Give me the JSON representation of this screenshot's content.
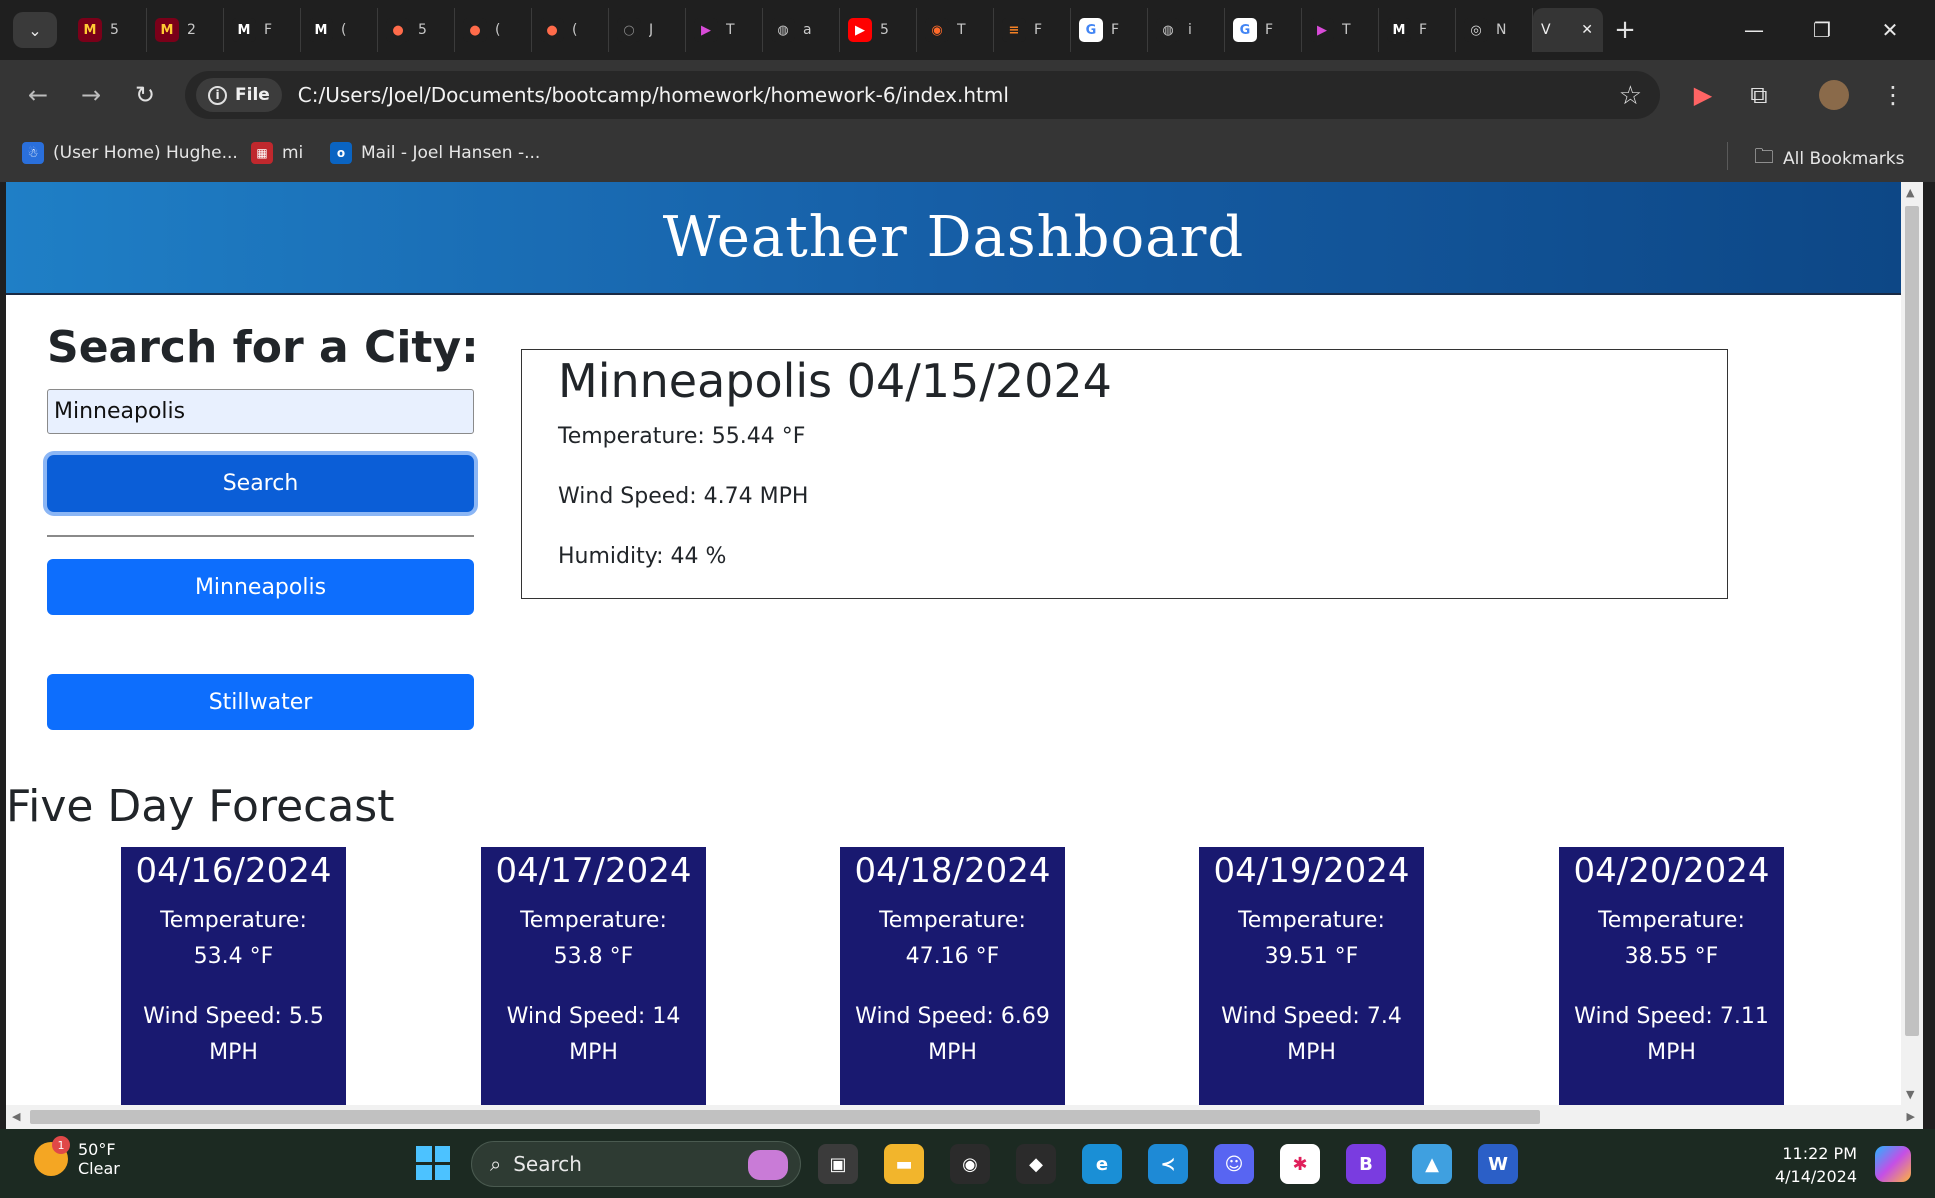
{
  "browser": {
    "tabs": [
      {
        "label": "5",
        "fav_text": "M",
        "fav_color": "#7a0019",
        "fav_fg": "#ffcc33"
      },
      {
        "label": "2",
        "fav_text": "M",
        "fav_color": "#7a0019",
        "fav_fg": "#ffcc33"
      },
      {
        "label": "F",
        "fav_text": "M",
        "fav_color": "#1f1f1f",
        "fav_fg": "#ffffff"
      },
      {
        "label": "(",
        "fav_text": "M",
        "fav_color": "#1f1f1f",
        "fav_fg": "#ffffff"
      },
      {
        "label": "5",
        "fav_text": "●",
        "fav_color": "#1f1f1f",
        "fav_fg": "#ff6b4a"
      },
      {
        "label": "(",
        "fav_text": "●",
        "fav_color": "#1f1f1f",
        "fav_fg": "#ff6b4a"
      },
      {
        "label": "(",
        "fav_text": "●",
        "fav_color": "#1f1f1f",
        "fav_fg": "#ff6b4a"
      },
      {
        "label": "J",
        "fav_text": "○",
        "fav_color": "#1f1f1f",
        "fav_fg": "#888888"
      },
      {
        "label": "T",
        "fav_text": "▶",
        "fav_color": "#1f1f1f",
        "fav_fg": "#d84bd8"
      },
      {
        "label": "a",
        "fav_text": "◍",
        "fav_color": "#1f1f1f",
        "fav_fg": "#cccccc"
      },
      {
        "label": "5",
        "fav_text": "▶",
        "fav_color": "#ff0000",
        "fav_fg": "#ffffff"
      },
      {
        "label": "T",
        "fav_text": "◉",
        "fav_color": "#1f1f1f",
        "fav_fg": "#ff6a2a"
      },
      {
        "label": "F",
        "fav_text": "≡",
        "fav_color": "#1f1f1f",
        "fav_fg": "#f48024"
      },
      {
        "label": "F",
        "fav_text": "G",
        "fav_color": "#ffffff",
        "fav_fg": "#4285f4"
      },
      {
        "label": "i",
        "fav_text": "◍",
        "fav_color": "#1f1f1f",
        "fav_fg": "#cccccc"
      },
      {
        "label": "F",
        "fav_text": "G",
        "fav_color": "#ffffff",
        "fav_fg": "#4285f4"
      },
      {
        "label": "T",
        "fav_text": "▶",
        "fav_color": "#1f1f1f",
        "fav_fg": "#d84bd8"
      },
      {
        "label": "F",
        "fav_text": "M",
        "fav_color": "#1f1f1f",
        "fav_fg": "#ffffff"
      },
      {
        "label": "N",
        "fav_text": "◎",
        "fav_color": "#1f1f1f",
        "fav_fg": "#dddddd"
      }
    ],
    "active_tab_label": "V",
    "url_scheme_chip": "File",
    "url": "C:/Users/Joel/Documents/bootcamp/homework/homework-6/index.html",
    "bookmarks": [
      {
        "label": "(User Home) Hughe...",
        "icon_color": "#2a6fdb",
        "icon_text": "☃"
      },
      {
        "label": "mi",
        "icon_color": "#c0282d",
        "icon_text": "▦"
      },
      {
        "label": "Mail - Joel Hansen -...",
        "icon_color": "#0a64c2",
        "icon_text": "o"
      }
    ],
    "all_bookmarks_label": "All Bookmarks"
  },
  "page": {
    "header_title": "Weather Dashboard",
    "search_title": "Search for a City:",
    "search_value": "Minneapolis",
    "search_button": "Search",
    "history": [
      "Minneapolis",
      "Stillwater"
    ],
    "current": {
      "heading": "Minneapolis 04/15/2024",
      "temperature": "Temperature: 55.44 °F",
      "wind": "Wind Speed: 4.74 MPH",
      "humidity": "Humidity: 44 %"
    },
    "forecast_title": "Five Day Forecast",
    "forecast": [
      {
        "date": "04/16/2024",
        "temp_label": "Temperature:",
        "temp": "53.4 °F",
        "wind_label": "Wind Speed: 5.5",
        "wind_unit": "MPH"
      },
      {
        "date": "04/17/2024",
        "temp_label": "Temperature:",
        "temp": "53.8 °F",
        "wind_label": "Wind Speed: 14",
        "wind_unit": "MPH"
      },
      {
        "date": "04/18/2024",
        "temp_label": "Temperature:",
        "temp": "47.16 °F",
        "wind_label": "Wind Speed: 6.69",
        "wind_unit": "MPH"
      },
      {
        "date": "04/19/2024",
        "temp_label": "Temperature:",
        "temp": "39.51 °F",
        "wind_label": "Wind Speed: 7.4",
        "wind_unit": "MPH"
      },
      {
        "date": "04/20/2024",
        "temp_label": "Temperature:",
        "temp": "38.55 °F",
        "wind_label": "Wind Speed: 7.11",
        "wind_unit": "MPH"
      }
    ]
  },
  "taskbar": {
    "weather_temp": "50°F",
    "weather_desc": "Clear",
    "weather_badge": "1",
    "search_label": "Search",
    "time": "11:22 PM",
    "date": "4/14/2024",
    "apps": [
      {
        "name": "task-view",
        "color": "#3b3b3b",
        "text": "▣"
      },
      {
        "name": "file-explorer",
        "color": "#f2b52c",
        "text": "▬"
      },
      {
        "name": "chrome",
        "color": "#2b2b2b",
        "text": "◉"
      },
      {
        "name": "git",
        "color": "#2b2b2b",
        "text": "◆"
      },
      {
        "name": "edge",
        "color": "#1a8fd6",
        "text": "e"
      },
      {
        "name": "vscode",
        "color": "#1e8ad6",
        "text": "≺"
      },
      {
        "name": "discord",
        "color": "#5865f2",
        "text": "☺"
      },
      {
        "name": "slack",
        "color": "#ffffff",
        "text": "✱"
      },
      {
        "name": "bootstrap",
        "color": "#7a3ce0",
        "text": "B"
      },
      {
        "name": "photos",
        "color": "#3fa0e0",
        "text": "▲"
      },
      {
        "name": "word",
        "color": "#2b5fc7",
        "text": "W"
      }
    ]
  },
  "colors": {
    "header_start": "#1f7fc6",
    "header_end": "#0d4786",
    "card_bg": "#191970",
    "primary_button": "#0d6efd"
  }
}
